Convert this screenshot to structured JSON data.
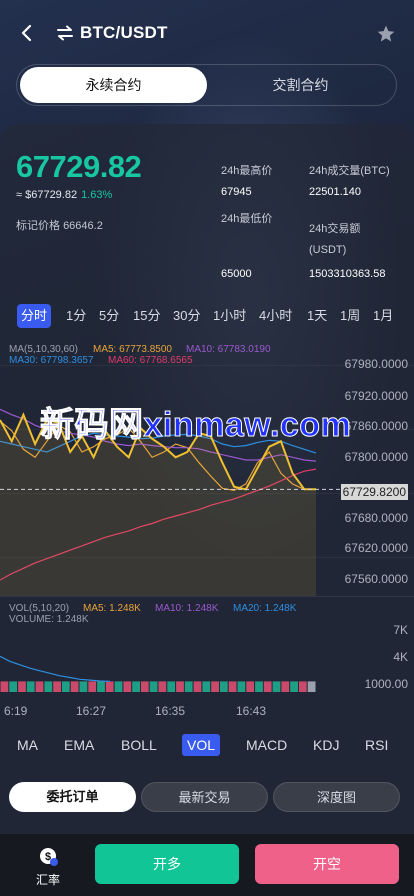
{
  "header": {
    "title": "BTC/USDT"
  },
  "tabs": [
    {
      "label": "永续合约"
    },
    {
      "label": "交割合约"
    }
  ],
  "price": {
    "last": "67729.82",
    "approx": "≈ $67729.82",
    "change": "1.63%",
    "mark_label": "标记价格",
    "mark_value": "66646.2"
  },
  "stats": {
    "high_label": "24h最高价",
    "high_value": "67945",
    "low_label": "24h最低价",
    "low_value": "65000",
    "vol_label": "24h成交量(BTC)",
    "vol_value": "22501.140",
    "amount_label": "24h交易额",
    "amount_unit": "(USDT)",
    "amount_value": "1503310363.58"
  },
  "periods": [
    {
      "label": "分时",
      "active": true
    },
    {
      "label": "1分"
    },
    {
      "label": "5分"
    },
    {
      "label": "15分"
    },
    {
      "label": "30分"
    },
    {
      "label": "1小时"
    },
    {
      "label": "4小时"
    },
    {
      "label": "1天"
    },
    {
      "label": "1周"
    },
    {
      "label": "1月"
    }
  ],
  "ma_legend": {
    "title": "MA(5,10,30,60)",
    "ma5": "MA5: 67773.8500",
    "ma10": "MA10: 67783.0190",
    "ma30": "MA30: 67798.3657",
    "ma60": "MA60: 67768.6565"
  },
  "price_axis": [
    "67980.0000",
    "67920.0000",
    "67860.0000",
    "67800.0000",
    "67740.0000",
    "67680.0000",
    "67620.0000",
    "67560.0000"
  ],
  "current_price_tag": "67729.8200",
  "watermark": "新码网xinmaw.com",
  "vol_legend": {
    "title": "VOL(5,10,20)",
    "ma5": "MA5: 1.248K",
    "ma10": "MA10: 1.248K",
    "ma20": "MA20: 1.248K",
    "volume": "VOLUME: 1.248K"
  },
  "vol_axis": [
    "7K",
    "4K",
    "1000.00"
  ],
  "time_axis": [
    "6:19",
    "16:27",
    "16:35",
    "16:43"
  ],
  "indicators": [
    {
      "label": "MA"
    },
    {
      "label": "EMA"
    },
    {
      "label": "BOLL"
    },
    {
      "label": "VOL",
      "active": true
    },
    {
      "label": "MACD"
    },
    {
      "label": "KDJ"
    },
    {
      "label": "RSI"
    }
  ],
  "subtabs": [
    {
      "label": "委托订单"
    },
    {
      "label": "最新交易"
    },
    {
      "label": "深度图"
    }
  ],
  "bottom": {
    "rate_label": "汇率",
    "long_label": "开多",
    "short_label": "开空"
  },
  "chart_data": {
    "type": "line",
    "ylim": [
      67530,
      68010
    ],
    "series": [
      {
        "name": "MA5",
        "color": "#e8a33a",
        "values": [
          67858,
          67840,
          67805,
          67790,
          67820,
          67850,
          67838,
          67800,
          67810,
          67825,
          67832,
          67845,
          67820,
          67790,
          67800,
          67815,
          67808,
          67780,
          67755,
          67732,
          67728,
          67740,
          67780,
          67800,
          67760,
          67740,
          67730,
          67730
        ]
      },
      {
        "name": "MA10",
        "color": "#9b59d0",
        "values": [
          67880,
          67870,
          67862,
          67850,
          67842,
          67840,
          67835,
          67832,
          67828,
          67820,
          67815,
          67812,
          67815,
          67812,
          67810,
          67808,
          67808,
          67806,
          67800,
          67795,
          67790,
          67785,
          67785,
          67790,
          67795,
          67790,
          67785,
          67783
        ]
      },
      {
        "name": "MA30",
        "color": "#2f8fe0",
        "values": [
          67820,
          67815,
          67810,
          67805,
          67800,
          67810,
          67820,
          67830,
          67835,
          67832,
          67830,
          67828,
          67825,
          67826,
          67830,
          67832,
          67833,
          67830,
          67825,
          67815,
          67810,
          67812,
          67818,
          67822,
          67820,
          67812,
          67805,
          67798
        ]
      },
      {
        "name": "MA60",
        "color": "#e03a6a",
        "values": [
          67560,
          67572,
          67582,
          67592,
          67600,
          67608,
          67616,
          67624,
          67632,
          67640,
          67646,
          67652,
          67660,
          67666,
          67674,
          67680,
          67686,
          67692,
          67700,
          67706,
          67712,
          67720,
          67728,
          67736,
          67746,
          67756,
          67764,
          67768
        ]
      },
      {
        "name": "Price",
        "color": "#f0c030",
        "values": [
          67860,
          67820,
          67870,
          67815,
          67860,
          67855,
          67800,
          67830,
          67790,
          67840,
          67810,
          67790,
          67845,
          67825,
          67810,
          67790,
          67800,
          67835,
          67830,
          67780,
          67735,
          67730,
          67770,
          67810,
          67820,
          67760,
          67730,
          67730
        ]
      }
    ],
    "current": 67729.82,
    "volume": {
      "ylim": [
        0,
        8000
      ],
      "bar_value": 1248,
      "bar_count": 36,
      "line_values": [
        4200,
        3600,
        3200,
        2800,
        2500,
        2200,
        1900,
        1700,
        1500,
        1400,
        1300,
        1250
      ]
    }
  }
}
